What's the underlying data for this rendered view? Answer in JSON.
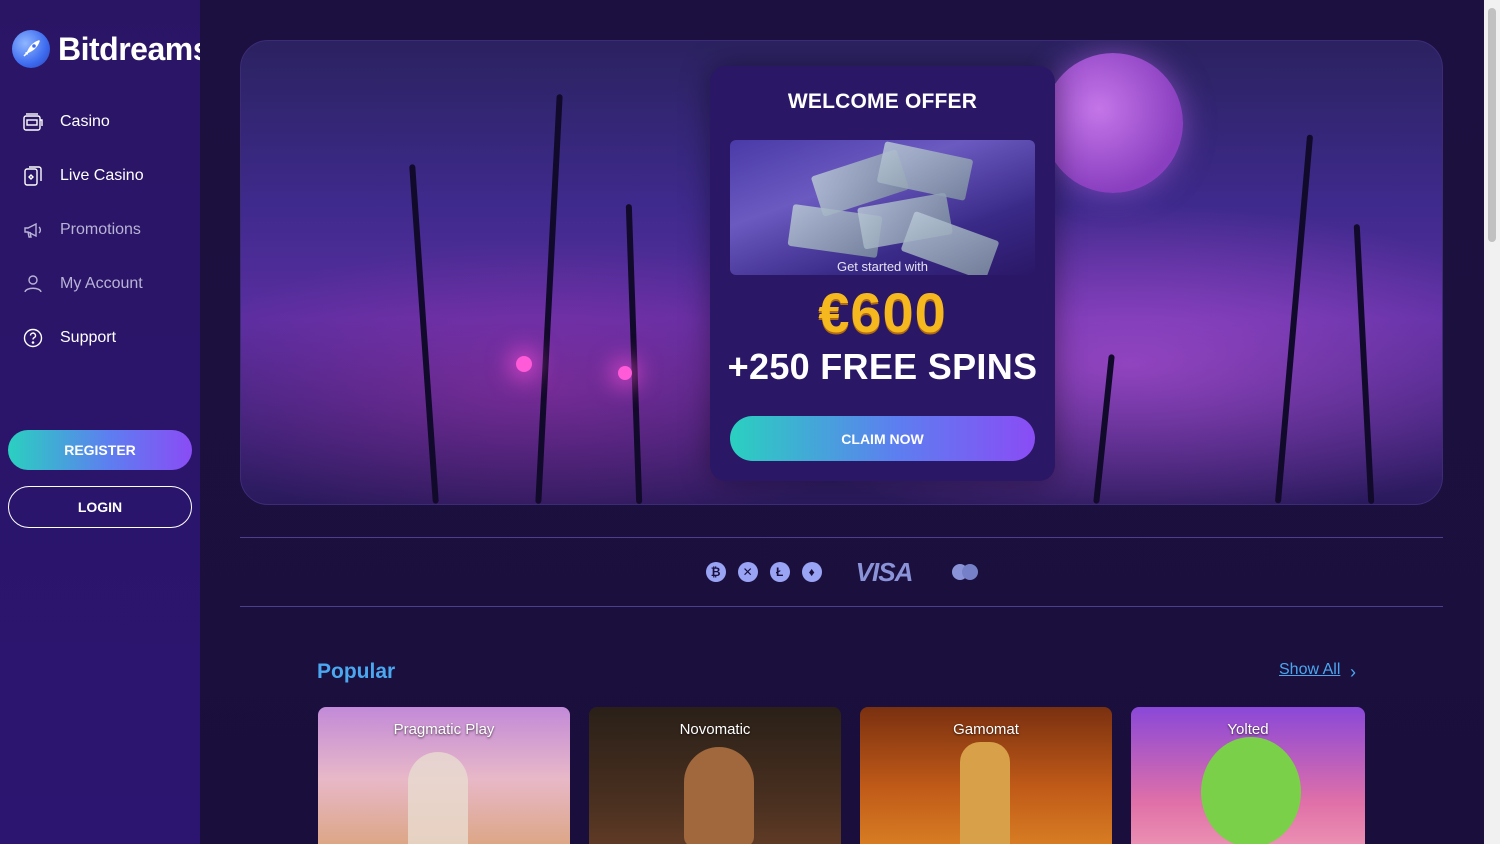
{
  "brand": {
    "name": "Bitdreams"
  },
  "sidebar": {
    "items": [
      {
        "label": "Casino",
        "icon": "slot-machine-icon"
      },
      {
        "label": "Live Casino",
        "icon": "cards-icon"
      },
      {
        "label": "Promotions",
        "icon": "megaphone-icon"
      },
      {
        "label": "My Account",
        "icon": "user-icon"
      },
      {
        "label": "Support",
        "icon": "help-icon"
      }
    ],
    "register_label": "REGISTER",
    "login_label": "LOGIN"
  },
  "hero": {
    "title": "WELCOME OFFER",
    "subtitle": "Get started with",
    "amount": "€600",
    "spins": "+250 FREE SPINS",
    "cta": "CLAIM NOW"
  },
  "payments": {
    "coins": [
      "₿",
      "✕",
      "Ł",
      "♦"
    ],
    "visa": "VISA"
  },
  "popular": {
    "title": "Popular",
    "show_all": "Show All",
    "games": [
      {
        "provider": "Pragmatic Play"
      },
      {
        "provider": "Novomatic"
      },
      {
        "provider": "Gamomat"
      },
      {
        "provider": "Yolted"
      }
    ]
  },
  "colors": {
    "accent": "#4aa7f0",
    "gold": "#f6b81f",
    "sidebar": "#2a1565",
    "background": "#1a0f3a"
  }
}
